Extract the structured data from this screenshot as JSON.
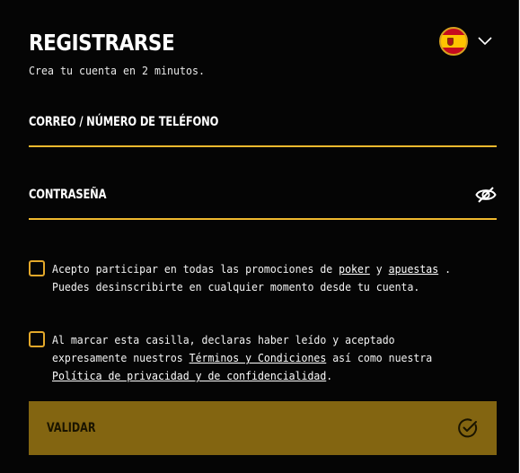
{
  "header": {
    "title": "REGISTRARSE",
    "subtitle": "Crea tu cuenta en 2 minutos."
  },
  "language": {
    "flag_icon": "spain-flag-icon",
    "chevron_icon": "chevron-down-icon"
  },
  "fields": {
    "email_label": "CORREO / NÚMERO DE TELÉFONO",
    "email_value": "",
    "password_label": "CONTRASEÑA",
    "password_value": "",
    "password_toggle_icon": "eye-icon"
  },
  "consents": {
    "promo": {
      "checked": false,
      "text_1": "Acepto participar en todas las promociones de ",
      "link_poker": "poker",
      "text_2": " y ",
      "link_bets": "apuestas",
      "text_3": " .",
      "text_4": "Puedes desinscribirte en cualquier momento desde tu cuenta."
    },
    "terms": {
      "checked": false,
      "text_1": "Al marcar esta casilla, declaras haber leído y aceptado expresamente nuestros ",
      "link_terms": "Términos y Condiciones",
      "text_2": " así como nuestra",
      "link_privacy": "Política de privacidad y de confidencialidad",
      "text_3": "."
    }
  },
  "submit": {
    "label": "VALIDAR",
    "icon": "check-circle-icon"
  },
  "colors": {
    "background": "#050505",
    "accent": "#f0b92e",
    "button": "#836511"
  }
}
